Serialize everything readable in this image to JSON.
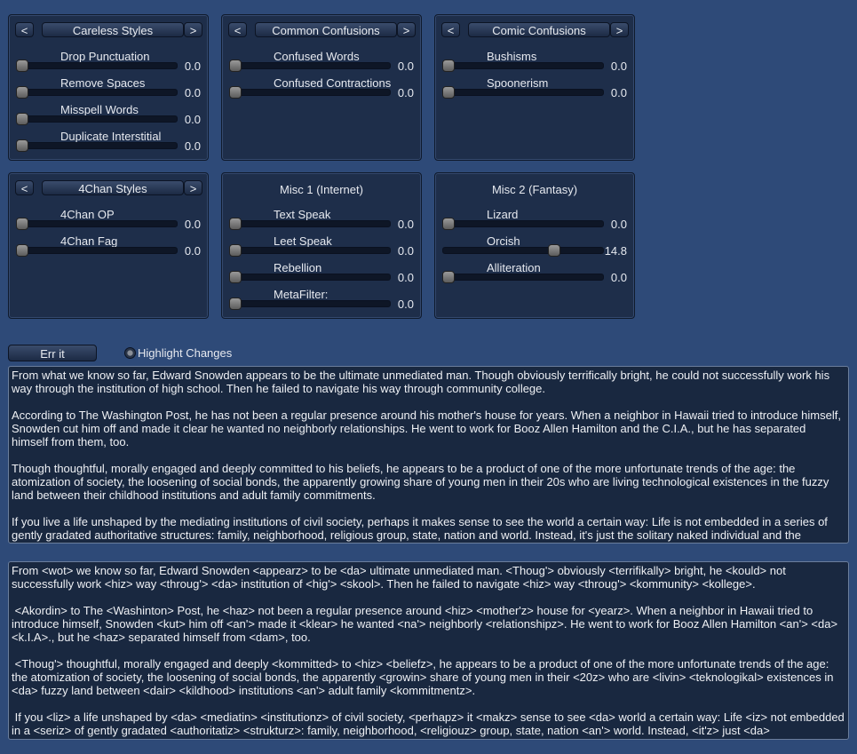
{
  "colors": {
    "background": "#2e4a78",
    "panel": "#1e2e4a",
    "textarea": "#192840"
  },
  "panels": [
    {
      "title": "Careless Styles",
      "has_nav": true,
      "sliders": [
        {
          "label": "Drop Punctuation",
          "value": "0.0",
          "fraction": 0
        },
        {
          "label": "Remove Spaces",
          "value": "0.0",
          "fraction": 0
        },
        {
          "label": "Misspell Words",
          "value": "0.0",
          "fraction": 0
        },
        {
          "label": "Duplicate Interstitial",
          "value": "0.0",
          "fraction": 0
        }
      ]
    },
    {
      "title": "Common Confusions",
      "has_nav": true,
      "sliders": [
        {
          "label": "Confused Words",
          "value": "0.0",
          "fraction": 0
        },
        {
          "label": "Confused Contractions",
          "value": "0.0",
          "fraction": 0
        }
      ]
    },
    {
      "title": "Comic Confusions",
      "has_nav": true,
      "sliders": [
        {
          "label": "Bushisms",
          "value": "0.0",
          "fraction": 0
        },
        {
          "label": "Spoonerism",
          "value": "0.0",
          "fraction": 0
        }
      ]
    },
    {
      "title": "4Chan Styles",
      "has_nav": true,
      "sliders": [
        {
          "label": "4Chan OP",
          "value": "0.0",
          "fraction": 0
        },
        {
          "label": "4Chan Fag",
          "value": "0.0",
          "fraction": 0
        }
      ]
    },
    {
      "title": "Misc 1 (Internet)",
      "has_nav": false,
      "sliders": [
        {
          "label": "Text Speak",
          "value": "0.0",
          "fraction": 0
        },
        {
          "label": "Leet Speak",
          "value": "0.0",
          "fraction": 0
        },
        {
          "label": "Rebellion",
          "value": "0.0",
          "fraction": 0
        },
        {
          "label": "MetaFilter:",
          "value": "0.0",
          "fraction": 0
        }
      ]
    },
    {
      "title": "Misc 2 (Fantasy)",
      "has_nav": false,
      "sliders": [
        {
          "label": "Lizard",
          "value": "0.0",
          "fraction": 0
        },
        {
          "label": "Orcish",
          "value": "14.8",
          "fraction": 0.71
        },
        {
          "label": "Alliteration",
          "value": "0.0",
          "fraction": 0
        }
      ]
    }
  ],
  "nav": {
    "prev": "<",
    "next": ">"
  },
  "controls": {
    "err_button": "Err it",
    "highlight_label": "Highlight Changes",
    "highlight_checked": true
  },
  "input_text": "From what we know so far, Edward Snowden appears to be the ultimate unmediated man. Though obviously terrifically bright, he could not successfully work his way through the institution of high school. Then he failed to navigate his way through community college.\n\nAccording to The Washington Post, he has not been a regular presence around his mother's house for years. When a neighbor in Hawaii tried to introduce himself, Snowden cut him off and made it clear he wanted no neighborly relationships. He went to work for Booz Allen Hamilton and the C.I.A., but he has separated himself from them, too.\n\nThough thoughtful, morally engaged and deeply committed to his beliefs, he appears to be a product of one of the more unfortunate trends of the age: the atomization of society, the loosening of social bonds, the apparently growing share of young men in their 20s who are living technological existences in the fuzzy land between their childhood institutions and adult family commitments.\n\nIf you live a life unshaped by the mediating institutions of civil society, perhaps it makes sense to see the world a certain way: Life is not embedded in a series of gently gradated authoritative structures: family, neighborhood, religious group, state, nation and world. Instead, it's just the solitary naked individual and the",
  "output_text": "From <wot> we know so far, Edward Snowden <appearz> to be <da> ultimate unmediated man. <Thoug'> obviously <terrifikally> bright, he <kould> not successfully work <hiz> way <throug'> <da> institution of <hig'> <skool>. Then he failed to navigate <hiz> way <throug'> <kommunity> <kollege>.\n\n <Akordin> to The <Washinton> Post, he <haz> not been a regular presence around <hiz> <mother'z> house for <yearz>. When a neighbor in Hawaii tried to introduce himself, Snowden <kut> him off <an'> made it <klear> he wanted <na'> neighborly <relationshipz>. He went to work for Booz Allen Hamilton <an'> <da> <k.I.A>., but he <haz> separated himself from <dam>, too.\n\n <Thoug'> thoughtful, morally engaged and deeply <kommitted> to <hiz> <beliefz>, he appears to be a product of one of the more unfortunate trends of the age: the atomization of society, the loosening of social bonds, the apparently <growin> share of young men in their <20z> who are <livin> <teknologikal> existences in <da> fuzzy land between <dair> <kildhood> institutions <an'> adult family <kommitmentz>.\n\n If you <liz> a life unshaped by <da> <mediatin> <institutionz> of civil society, <perhapz> it <makz> sense to see <da> world a certain way: Life <iz> not embedded in a <seriz> of gently gradated <authoritatiz> <strukturz>: family, neighborhood, <religiouz> group, state, nation <an'> world. Instead, <it'z> just <da>"
}
